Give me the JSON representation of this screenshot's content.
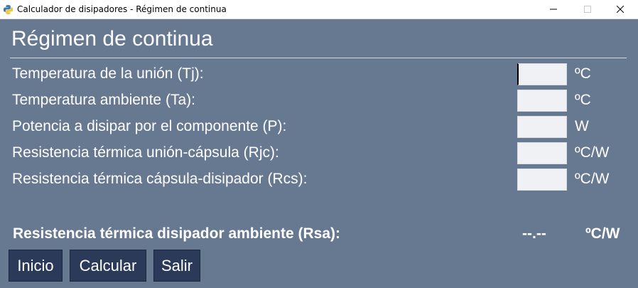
{
  "window": {
    "title": "Calculador de disipadores - Régimen de continua"
  },
  "heading": "Régimen de continua",
  "fields": [
    {
      "label": "Temperatura de la unión (Tj):",
      "value": "",
      "unit": "ºC"
    },
    {
      "label": "Temperatura ambiente (Ta):",
      "value": "",
      "unit": "ºC"
    },
    {
      "label": "Potencia a disipar por el componente (P):",
      "value": "",
      "unit": "W"
    },
    {
      "label": "Resistencia térmica unión-cápsula (Rjc):",
      "value": "",
      "unit": "ºC/W"
    },
    {
      "label": "Resistencia térmica cápsula-disipador (Rcs):",
      "value": "",
      "unit": "ºC/W"
    }
  ],
  "result": {
    "label": "Resistencia térmica disipador ambiente (Rsa):",
    "value": "--.--",
    "unit": "ºC/W"
  },
  "buttons": {
    "inicio": "Inicio",
    "calcular": "Calcular",
    "salir": "Salir"
  },
  "icons": {
    "app": "python-icon",
    "minimize": "minimize-icon",
    "maximize": "maximize-icon",
    "close": "close-icon"
  },
  "colors": {
    "background": "#677891",
    "button": "#2a3a58",
    "input": "#eff1f5",
    "text": "#ffffff"
  }
}
